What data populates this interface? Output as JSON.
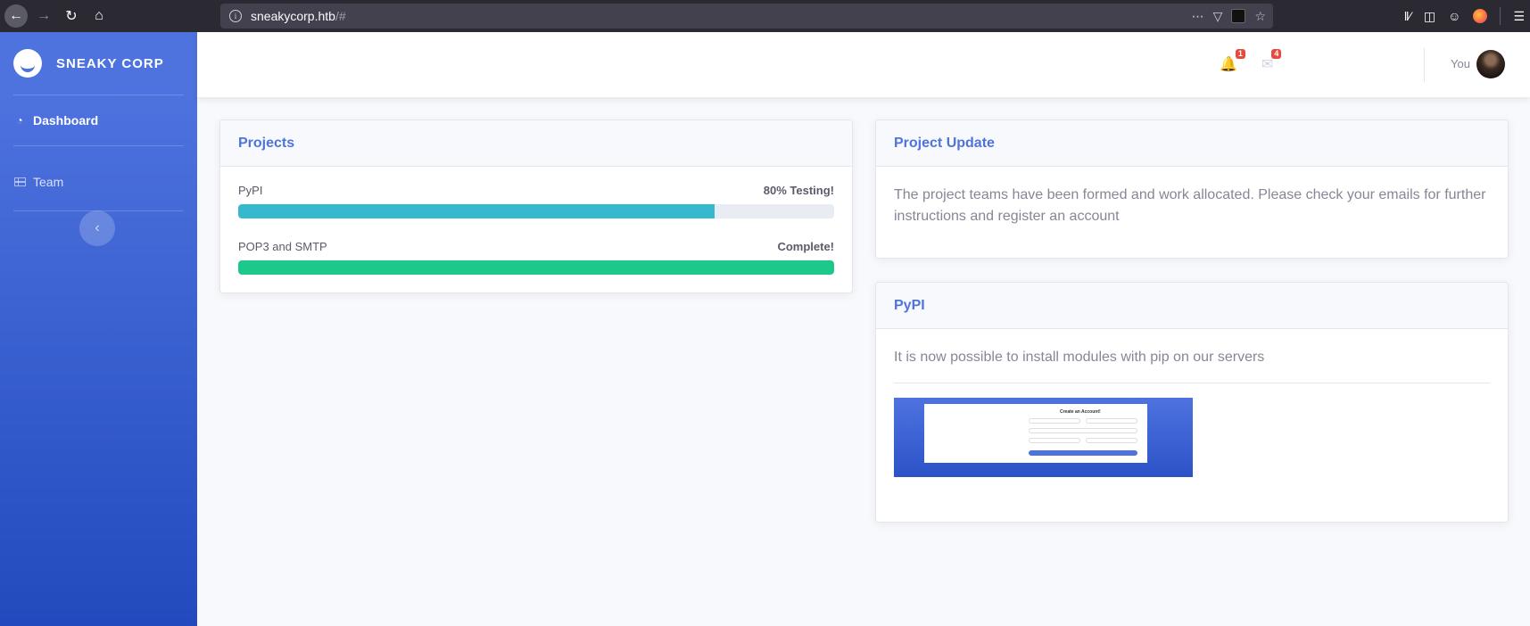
{
  "browser": {
    "url_host": "sneakycorp.htb",
    "url_path": "/#"
  },
  "sidebar": {
    "brand": "SNEAKY CORP",
    "items": [
      {
        "label": "Dashboard",
        "icon": "tachometer-icon",
        "active": true
      },
      {
        "label": "Team",
        "icon": "table-icon",
        "active": false
      }
    ],
    "toggle_icon": "chevron-left-icon"
  },
  "topbar": {
    "alerts_count": "1",
    "messages_count": "4",
    "user_name": "You"
  },
  "projects_card": {
    "title": "Projects",
    "items": [
      {
        "name": "PyPI",
        "status": "80% Testing!",
        "progress": 80,
        "color": "#36b9cc"
      },
      {
        "name": "POP3 and SMTP",
        "status": "Complete!",
        "progress": 100,
        "color": "#1cc88a"
      }
    ]
  },
  "update_card": {
    "title": "Project Update",
    "text": "The project teams have been formed and work allocated. Please check your emails for further instructions and register an account"
  },
  "pypi_card": {
    "title": "PyPI",
    "text": "It is now possible to install modules with pip on our servers",
    "screenshot_title": "Create an Account!"
  },
  "colors": {
    "primary": "#4e73df",
    "info": "#36b9cc",
    "success": "#1cc88a",
    "danger": "#e74a3b"
  }
}
